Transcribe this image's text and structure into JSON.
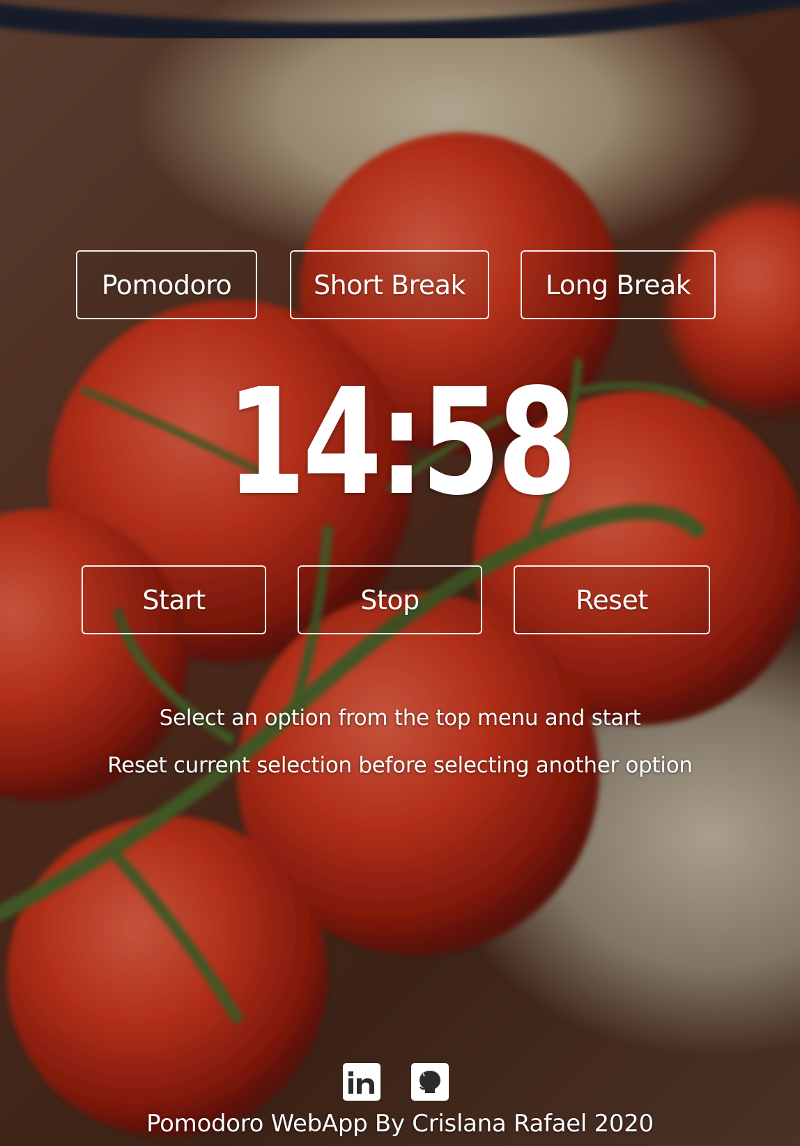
{
  "modes": {
    "pomodoro_label": "Pomodoro",
    "short_break_label": "Short Break",
    "long_break_label": "Long Break"
  },
  "timer": {
    "display": "14:58"
  },
  "controls": {
    "start_label": "Start",
    "stop_label": "Stop",
    "reset_label": "Reset"
  },
  "instructions": {
    "line1": "Select an option from the top menu and start",
    "line2": "Reset current selection before selecting another option"
  },
  "social": {
    "linkedin_icon": "linkedin-icon",
    "github_icon": "github-icon"
  },
  "footer": {
    "credit": "Pomodoro WebApp By Crislana Rafael 2020"
  }
}
